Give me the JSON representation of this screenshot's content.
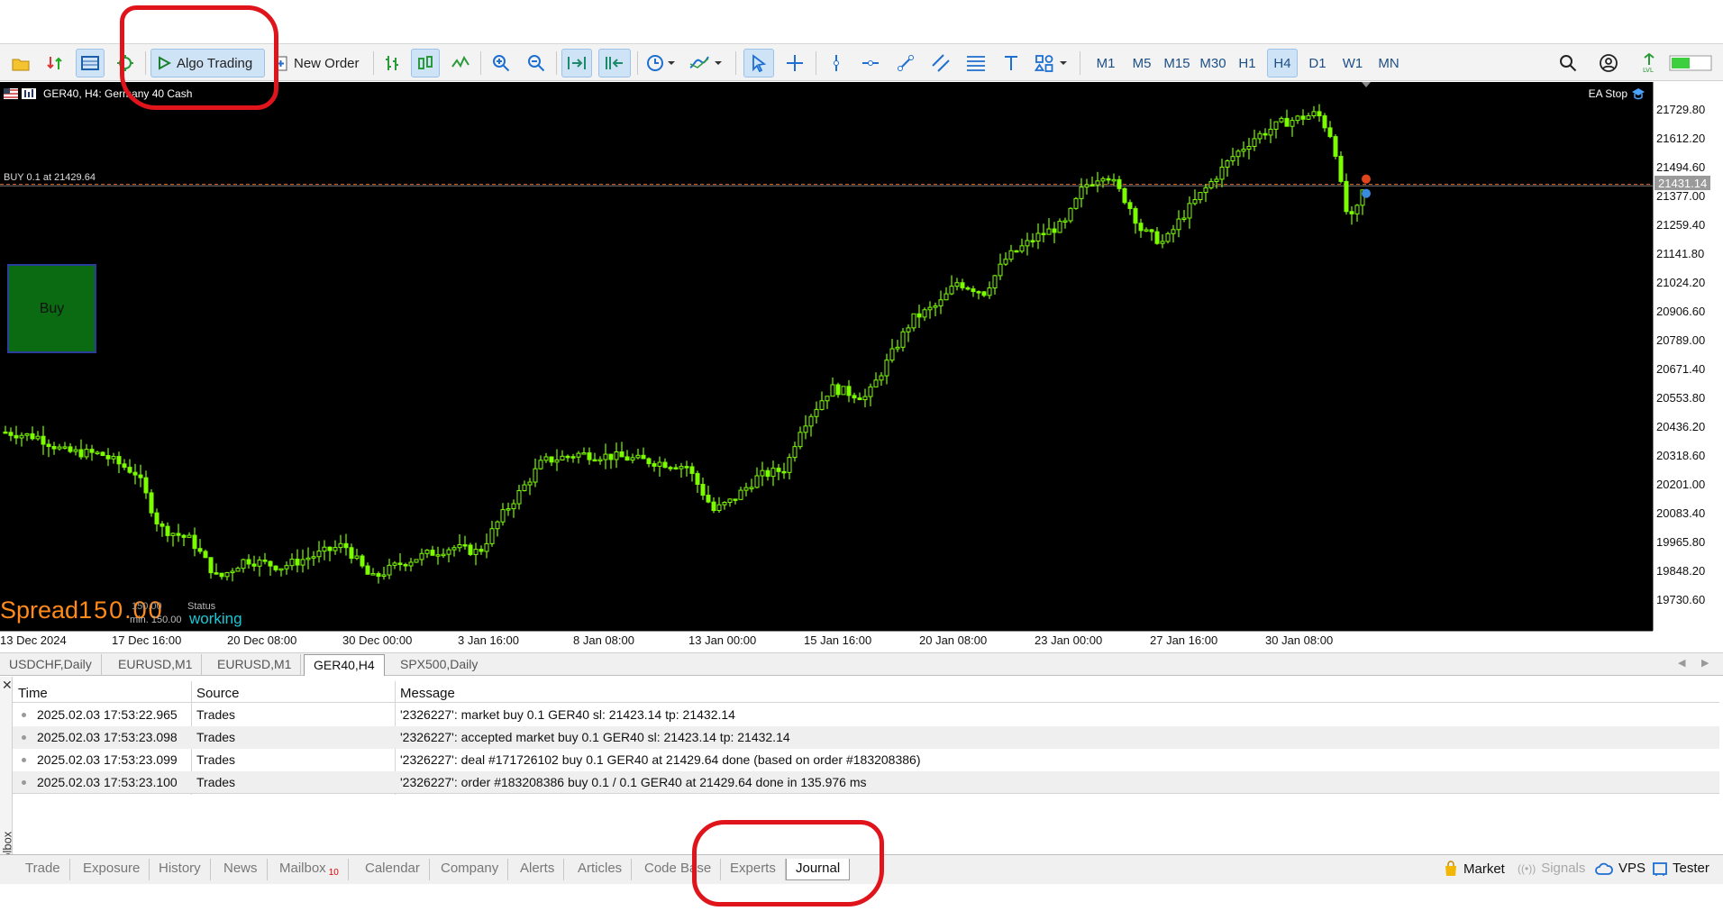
{
  "toolbar": {
    "algo_trading": "Algo Trading",
    "new_order": "New Order",
    "timeframes": [
      "M1",
      "M5",
      "M15",
      "M30",
      "H1",
      "H4",
      "D1",
      "W1",
      "MN"
    ],
    "active_timeframe": "H4"
  },
  "chart": {
    "symbol_label": "GER40, H4:  Germany 40 Cash",
    "ea_label": "EA Stop",
    "order_line_label": "BUY 0.1 at 21429.64",
    "current_price": "21431.14",
    "buy_button": "Buy",
    "spread_label": "Spread",
    "spread_value": "150.00",
    "overlay_status": "Status",
    "overlay_working": "working",
    "overlay_small_1": "150.00",
    "overlay_small_2": "min. 150.00",
    "price_labels": [
      "21729.80",
      "21612.20",
      "21494.60",
      "21377.00",
      "21259.40",
      "21141.80",
      "21024.20",
      "20906.60",
      "20789.00",
      "20671.40",
      "20553.80",
      "20436.20",
      "20318.60",
      "20201.00",
      "20083.40",
      "19965.80",
      "19848.20",
      "19730.60"
    ],
    "time_labels": [
      "13 Dec 2024",
      "17 Dec 16:00",
      "20 Dec 08:00",
      "30 Dec 00:00",
      "3 Jan 16:00",
      "8 Jan 08:00",
      "13 Jan 00:00",
      "15 Jan 16:00",
      "20 Jan 08:00",
      "23 Jan 00:00",
      "27 Jan 16:00",
      "30 Jan 08:00"
    ]
  },
  "chart_tabs": [
    "USDCHF,Daily",
    "EURUSD,M1",
    "EURUSD,M1",
    "GER40,H4",
    "SPX500,Daily"
  ],
  "active_chart_tab": "GER40,H4",
  "journal": {
    "headers": {
      "time": "Time",
      "source": "Source",
      "message": "Message"
    },
    "rows": [
      {
        "time": "2025.02.03 17:53:22.965",
        "source": "Trades",
        "message": "'2326227': market buy 0.1 GER40 sl: 21423.14 tp: 21432.14"
      },
      {
        "time": "2025.02.03 17:53:23.098",
        "source": "Trades",
        "message": "'2326227': accepted market buy 0.1 GER40 sl: 21423.14 tp: 21432.14"
      },
      {
        "time": "2025.02.03 17:53:23.099",
        "source": "Trades",
        "message": "'2326227': deal #171726102 buy 0.1 GER40 at 21429.64 done (based on order #183208386)"
      },
      {
        "time": "2025.02.03 17:53:23.100",
        "source": "Trades",
        "message": "'2326227': order #183208386 buy 0.1 / 0.1 GER40 at 21429.64 done in 135.976 ms"
      }
    ]
  },
  "bottom_tabs": [
    "Trade",
    "Exposure",
    "History",
    "News",
    "Mailbox",
    "Calendar",
    "Company",
    "Alerts",
    "Articles",
    "Code Base",
    "Experts",
    "Journal"
  ],
  "mailbox_badge": "10",
  "active_bottom_tab": "Journal",
  "toolbox_label": "Toolbox",
  "right_tools": {
    "market": "Market",
    "signals": "Signals",
    "vps": "VPS",
    "tester": "Tester"
  },
  "colors": {
    "bull": "#7CFC00",
    "chart_bg": "#000000",
    "accent": "#1d6fd1",
    "annotation": "#e0141b",
    "spread": "#ff8a1a",
    "working": "#19c8d6"
  }
}
